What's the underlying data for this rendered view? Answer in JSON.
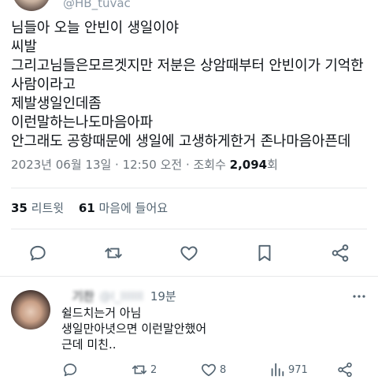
{
  "tweet": {
    "author_handle": "@HB_tuvac",
    "lines": [
      "님들아 오늘 안빈이 생일이야",
      "씨발",
      "그리고님들은모르겟지만 저분은 상암때부터 안빈이가 기억한",
      "사람이라고",
      "제발생일인데좀",
      "이런말하는나도마음아파",
      "안그래도 공항때문에 생일에 고생하게한거 존나마음아픈데"
    ],
    "timestamp": "2023년 06월 13일 · 12:50 오전 · 조회수 ",
    "views": "2,094",
    "views_suffix": "회"
  },
  "stats": {
    "retweets_count": "35",
    "retweets_label": "리트윗",
    "likes_count": "61",
    "likes_label": "마음에 들어요"
  },
  "actions": {
    "icons": [
      "reply-icon",
      "retweet-icon",
      "like-icon",
      "bookmark-icon",
      "share-icon"
    ]
  },
  "reply": {
    "name": "ᅟ기찬",
    "handle": "@l_lllllll",
    "time": "19분",
    "lines": [
      "쉴드치는거 아님",
      "생일만아녓으면 이런말안했어",
      "근데 미친.."
    ],
    "retweets": "2",
    "likes": "8",
    "views": "971"
  },
  "colors": {
    "text": "#0f1419",
    "secondary": "#536471",
    "divider": "#e7e9ea"
  }
}
